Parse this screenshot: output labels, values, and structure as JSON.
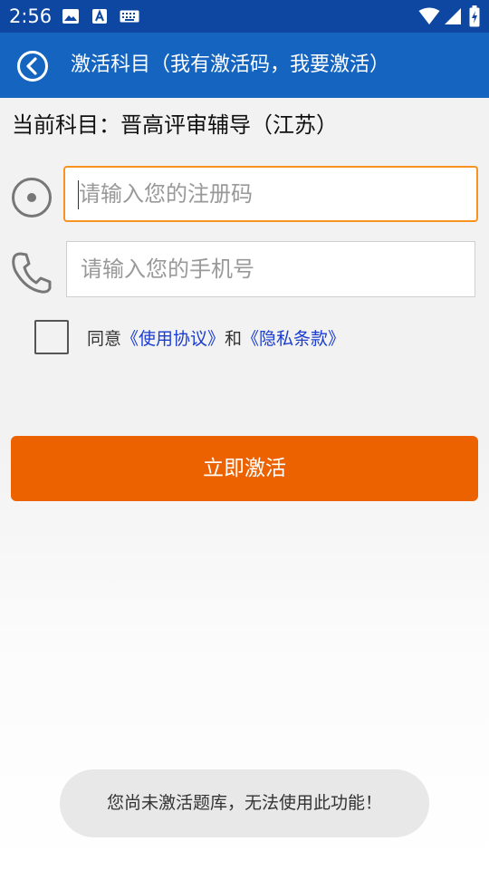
{
  "status_bar": {
    "time": "2:56",
    "icons": [
      "image-icon",
      "a-text-icon",
      "keyboard-icon",
      "wifi-icon",
      "signal-icon",
      "battery-charging-icon"
    ],
    "background": "#0d47a1"
  },
  "app_bar": {
    "back_icon": "back-circle-icon",
    "title": "激活科目（我有激活码，我要激活）",
    "background": "#1565c0"
  },
  "subject": {
    "text": "当前科目：晋高评审辅导（江苏）"
  },
  "form": {
    "code_icon": "disc-icon",
    "code_placeholder": "请输入您的注册码",
    "code_value": "",
    "phone_icon": "phone-icon",
    "phone_placeholder": "请输入您的手机号",
    "phone_value": "",
    "agree_checked": false,
    "agree_prefix": "同意",
    "agree_terms": "《使用协议》",
    "agree_and": "和",
    "agree_privacy": "《隐私条款》",
    "focus_color": "#f7931e",
    "link_color": "#1a3ccf"
  },
  "activate_button": {
    "label": "立即激活",
    "color": "#ec6200"
  },
  "toast": {
    "message": "您尚未激活题库，无法使用此功能！"
  }
}
